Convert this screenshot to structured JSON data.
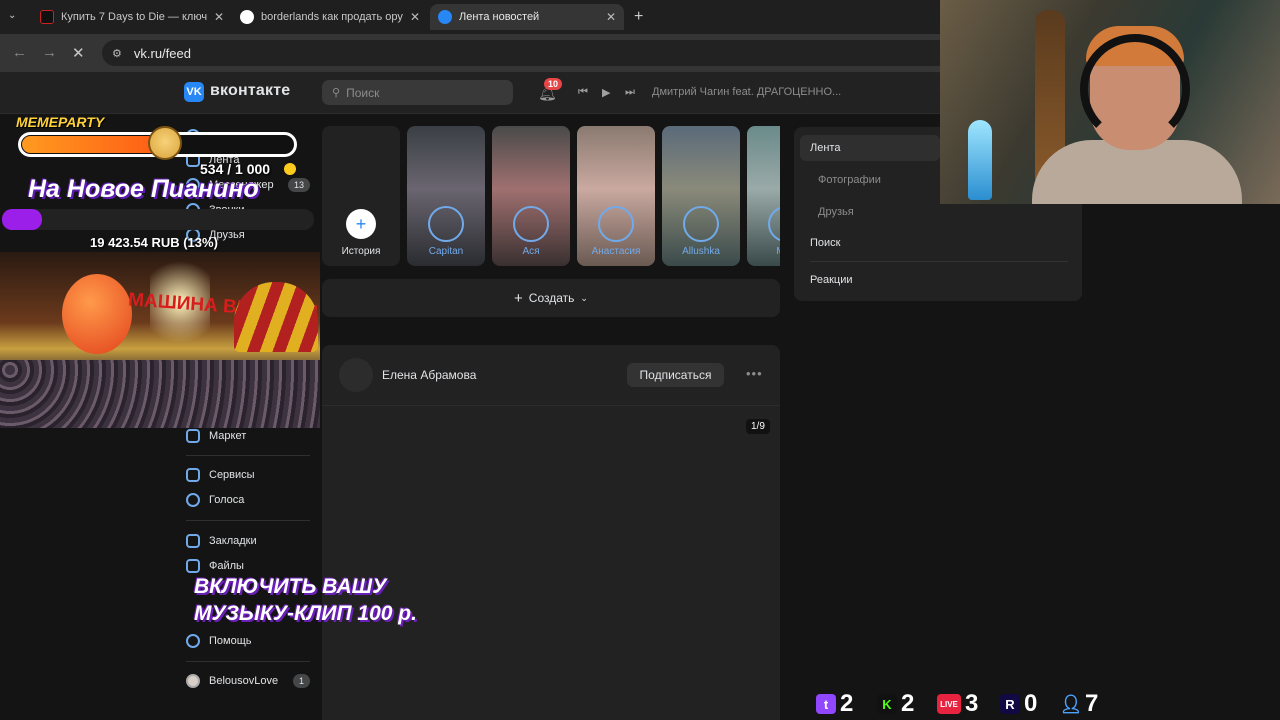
{
  "browser": {
    "tabs": [
      {
        "title": "Купить 7 Days to Die — ключ"
      },
      {
        "title": "borderlands как продать оруж"
      },
      {
        "title": "Лента новостей"
      }
    ],
    "new_tab_symbol": "+",
    "url": "vk.ru/feed"
  },
  "vk": {
    "logo_letter": "VK",
    "logo_text": "вконтакте",
    "search_placeholder": "Поиск",
    "notifications_count": "10",
    "now_playing": "Дмитрий Чагин feat. ДРАГОЦЕННО...",
    "left_menu": {
      "feed": "Лента",
      "messenger": "Мессенджер",
      "messenger_count": "13",
      "calls": "Звонки",
      "friends": "Друзья",
      "market": "Маркет",
      "services": "Сервисы",
      "votes": "Голоса",
      "bookmarks": "Закладки",
      "files": "Файлы",
      "help": "Помощь",
      "user": "BelousovLove",
      "user_count": "1"
    },
    "stories": [
      {
        "name": "История"
      },
      {
        "name": "Capitan"
      },
      {
        "name": "Ася"
      },
      {
        "name": "Анастасия"
      },
      {
        "name": "Allushka"
      },
      {
        "name": "Мар"
      }
    ],
    "create_label": "Создать",
    "post": {
      "author": "Елена Абрамова",
      "subscribe": "Подписаться",
      "photo_counter": "1/9"
    },
    "right_menu": {
      "feed": "Лента",
      "photos": "Фотографии",
      "friends": "Друзья",
      "search": "Поиск",
      "reactions": "Реакции"
    }
  },
  "overlay": {
    "goal_logo": "MEMEPARTY",
    "goal_count": "534 / 1 000",
    "goal_progress": 0.534,
    "donate_title": "На Новое Пианино",
    "donate_amount": "19 423.54 RUB (13%)",
    "donate_progress": 0.13,
    "video_text": "МАШИНА ВРЕМЕНИ",
    "promo_line1": "ВКЛЮЧИТЬ ВАШУ",
    "promo_line2": "МУЗЫКУ-КЛИП 100 р.",
    "stats": [
      {
        "icon": "twitch-icon",
        "value": "2",
        "color": "#9146ff"
      },
      {
        "icon": "kick-icon",
        "value": "2",
        "color": "#53fc18"
      },
      {
        "icon": "vklive-icon",
        "value": "3",
        "color": "#2787f5"
      },
      {
        "icon": "rutube-icon",
        "value": "0",
        "color": "#e8233f"
      },
      {
        "icon": "viewers-icon",
        "value": "7",
        "color": "#4aa3ff"
      }
    ]
  }
}
